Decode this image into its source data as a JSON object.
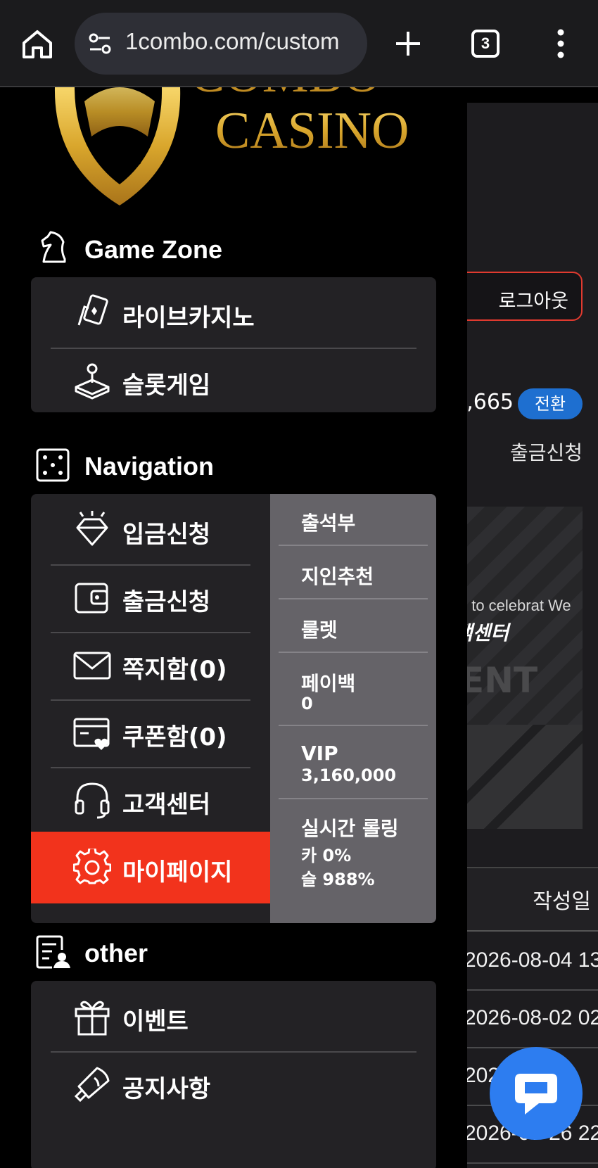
{
  "browser": {
    "url": "1combo.com/custom",
    "tab_count": "3"
  },
  "logo": {
    "line1": "COMBO",
    "line2": "CASINO"
  },
  "game_zone": {
    "title": "Game Zone",
    "items": [
      {
        "label": "라이브카지노",
        "icon": "cards-icon"
      },
      {
        "label": "슬롯게임",
        "icon": "joystick-icon"
      }
    ]
  },
  "navigation": {
    "title": "Navigation",
    "items": [
      {
        "label": "입금신청",
        "icon": "diamond-icon"
      },
      {
        "label": "출금신청",
        "icon": "wallet-icon"
      },
      {
        "label": "쪽지함(0)",
        "icon": "mail-icon"
      },
      {
        "label": "쿠폰함(0)",
        "icon": "coupon-icon"
      },
      {
        "label": "고객센터",
        "icon": "headset-icon"
      },
      {
        "label": "마이페이지",
        "icon": "gear-icon"
      }
    ],
    "side": [
      {
        "title": "출석부"
      },
      {
        "title": "지인추천"
      },
      {
        "title": "룰렛"
      },
      {
        "title": "페이백",
        "sub": "0"
      },
      {
        "title": "VIP",
        "sub": "3,160,000"
      },
      {
        "title": "실시간 롤링",
        "sub": "카 0%",
        "sub2": "슬 988%"
      }
    ]
  },
  "other": {
    "title": "other",
    "items": [
      {
        "label": "이벤트",
        "icon": "gift-icon"
      },
      {
        "label": "공지사항",
        "icon": "megaphone-icon"
      }
    ]
  },
  "background_page": {
    "logout": "로그아웃",
    "balance": ",665",
    "convert": "전환",
    "withdraw": "출금신청",
    "banner_text1": "t to celebrat  We",
    "banner_text2": "객센터",
    "banner_text3": "ENT",
    "date_header": "작성일",
    "dates": [
      "2026-08-04 13",
      "2026-08-02 02",
      "202",
      "2026-07-26 22"
    ]
  },
  "colors": {
    "accent_red": "#f2331c",
    "panel": "#232225",
    "side_panel": "#656368",
    "logout_border": "#e03a2f",
    "convert_blue": "#1e6fd0",
    "chat_blue": "#2d7df0",
    "gold": "#d9a62c"
  }
}
